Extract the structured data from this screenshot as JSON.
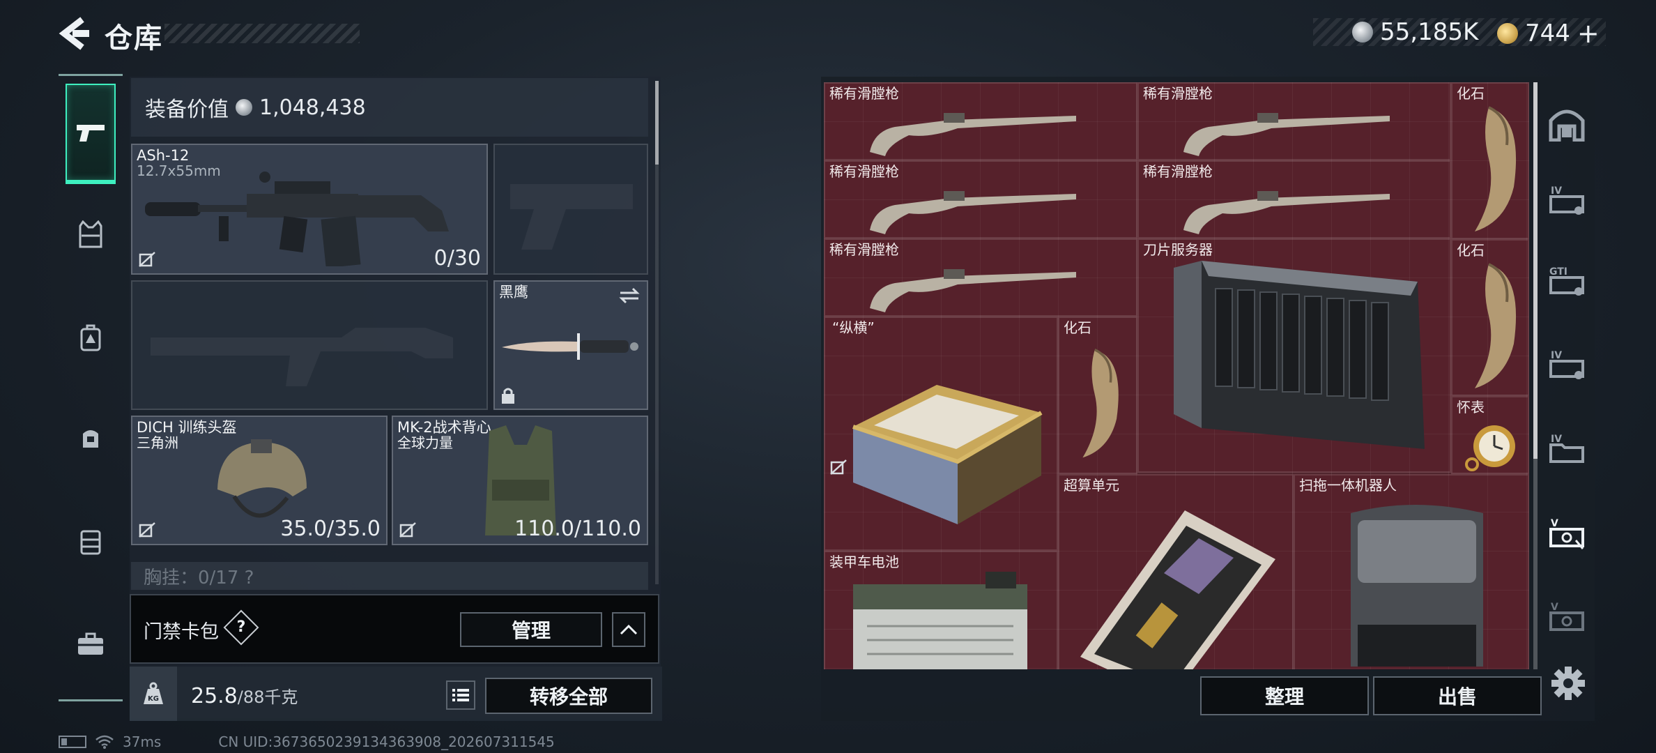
{
  "header": {
    "title": "仓库",
    "currency_silver": "55,185K",
    "currency_gold": "744",
    "add_label": "+"
  },
  "equipment": {
    "value_label": "装备价值",
    "value": "1,048,438",
    "primary_weapon": {
      "name": "ASh-12",
      "caliber": "12.7x55mm",
      "ammo": "0/30"
    },
    "melee": {
      "name": "黑鹰"
    },
    "helmet": {
      "name": "DICH 训练头盔",
      "brand": "三角洲",
      "durability": "35.0/35.0"
    },
    "vest": {
      "name": "MK-2战术背心",
      "brand": "全球力量",
      "durability": "110.0/110.0"
    },
    "chest_rig_partial": "胸挂：0/17 ?"
  },
  "card_pack": {
    "label": "门禁卡包",
    "help": "?",
    "manage_label": "管理"
  },
  "weight": {
    "current": "25.8",
    "max": "/88千克",
    "transfer_label": "转移全部"
  },
  "status": {
    "ping": "37ms",
    "uid": "CN UID:3673650239134363908_202607311545"
  },
  "storage": {
    "items": [
      {
        "name": "稀有滑膛枪"
      },
      {
        "name": "稀有滑膛枪"
      },
      {
        "name": "化石"
      },
      {
        "name": "稀有滑膛枪"
      },
      {
        "name": "稀有滑膛枪"
      },
      {
        "name": "稀有滑膛枪"
      },
      {
        "name": "刀片服务器"
      },
      {
        "name": "化石"
      },
      {
        "name": "“纵横”"
      },
      {
        "name": "化石"
      },
      {
        "name": "怀表"
      },
      {
        "name": "超算单元"
      },
      {
        "name": "扫拖一体机器人"
      },
      {
        "name": "装甲车电池"
      }
    ],
    "sort_label": "整理",
    "sell_label": "出售"
  },
  "colors": {
    "accent": "#3ef0c0",
    "grid_bg": "#4a1e27"
  }
}
